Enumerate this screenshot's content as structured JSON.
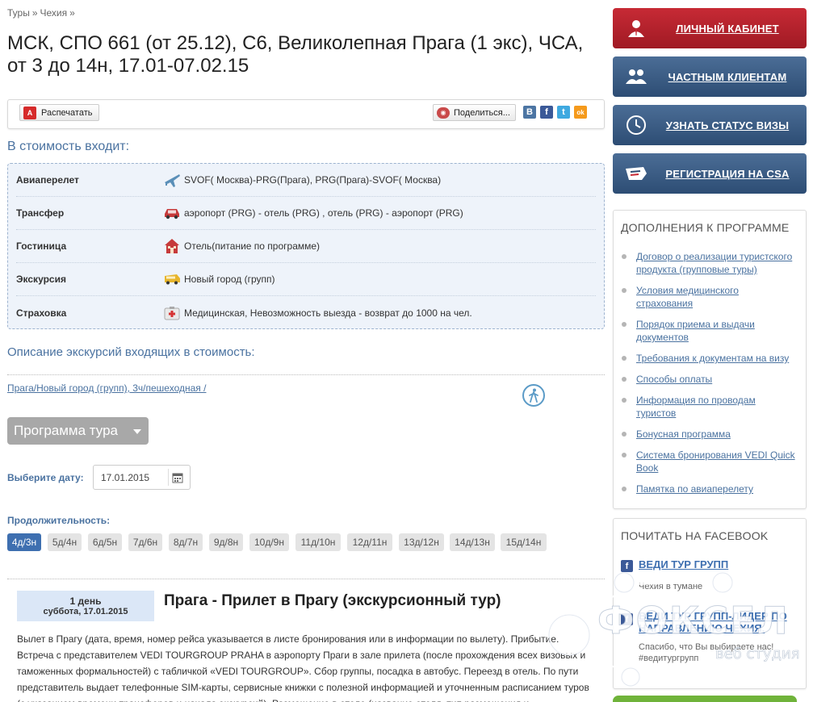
{
  "breadcrumb": {
    "items": [
      "Туры",
      "Чехия"
    ],
    "separator": "»"
  },
  "page": {
    "title": "МСК, СПО 661 (от 25.12), C6, Великолепная Прага (1 экс), ЧСА, от 3 до 14н, 17.01-07.02.15"
  },
  "toolbar": {
    "print_label": "Распечатать",
    "pdf_icon_text": "A",
    "share_label": "Поделиться...",
    "social": [
      {
        "letter": "В",
        "color": "#4c75a3"
      },
      {
        "letter": "f",
        "color": "#3b5998"
      },
      {
        "letter": "t",
        "color": "#3fa9e0"
      },
      {
        "letter": "ok",
        "color": "#f59a1c"
      }
    ]
  },
  "included": {
    "title": "В стоимость входит:",
    "rows": [
      {
        "label": "Авиаперелет",
        "icon": "plane-icon",
        "value": "SVOF( Москва)-PRG(Прага), PRG(Прага)-SVOF( Москва)"
      },
      {
        "label": "Трансфер",
        "icon": "car-icon",
        "value": "аэропорт (PRG) - отель (PRG) , отель (PRG) - аэропорт (PRG)"
      },
      {
        "label": "Гостиница",
        "icon": "hotel-icon",
        "value": "Отель(питание по программе)"
      },
      {
        "label": "Экскурсия",
        "icon": "bus-icon",
        "value": "Новый город (групп)"
      },
      {
        "label": "Страховка",
        "icon": "medkit-icon",
        "value": "Медицинская, Невозможность выезда - возврат до 1000 на чел."
      }
    ]
  },
  "excursions": {
    "title": "Описание экскурсий входящих в стоимость:",
    "link": "Прага/Новый город (групп), 3ч/пешеходная /"
  },
  "program": {
    "button_label": "Программа тура"
  },
  "date": {
    "label": "Выберите дату:",
    "value": "17.01.2015"
  },
  "duration": {
    "label": "Продолжительность:",
    "options": [
      "4д/3н",
      "5д/4н",
      "6д/5н",
      "7д/6н",
      "8д/7н",
      "9д/8н",
      "10д/9н",
      "11д/10н",
      "12д/11н",
      "13д/12н",
      "14д/13н",
      "15д/14н"
    ],
    "selected": "4д/3н"
  },
  "day": {
    "number": "1 день",
    "date": "суббота, 17.01.2015",
    "title": "Прага - Прилет в Прагу (экскурсионный тур)",
    "text": "Вылет в Прагу (дата, время, номер рейса указывается в листе бронирования или в информации по вылету). Прибытие. Встреча с представителем VEDI TOURGROUP PRAHA в аэропорту Праги в зале прилета (после прохождения всех визовых и таможенных формальностей) с табличкой «VEDI TOURGROUP». Сбор группы, посадка в автобус. Переезд в отель. По пути представитель выдает телефонные SIM-карты, сервисные книжки с полезной информацией и уточненным расписанием туров (с указанием времени трансферов и начала экскурсий). Размещение в отеле (название отеля, тип размещения и"
  },
  "sidebar": {
    "buttons": [
      {
        "label": "ЛИЧНЫЙ КАБИНЕТ",
        "icon": "user-icon"
      },
      {
        "label": "ЧАСТНЫМ КЛИЕНТАМ",
        "icon": "group-icon"
      },
      {
        "label": "УЗНАТЬ СТАТУС ВИЗЫ",
        "icon": "clock-icon"
      },
      {
        "label": "РЕГИСТРАЦИЯ НА CSA",
        "icon": "csa-logo-icon"
      }
    ],
    "addons": {
      "title": "ДОПОЛНЕНИЯ К ПРОГРАММЕ",
      "items": [
        "Договор о реализации туристского продукта (групповые туры)",
        "Условия медицинского страхования",
        "Порядок приема и выдачи документов",
        "Требования к документам на визу",
        "Способы оплаты",
        "Информация по проводам туристов",
        "Бонусная программа",
        "Система бронирования VEDI Quick Book",
        "Памятка по авиаперелету"
      ]
    },
    "facebook": {
      "title": "ПОЧИТАТЬ НА FACEBOOK",
      "posts": [
        {
          "name": "ВЕДИ ТУР ГРУПП",
          "sub": "Чехия в тумане"
        },
        {
          "name": "ВЕДИ ТУР ГРУПП-ЛИДЕР ПО НАПРАВЛЕНИЮ ЧЕХИЯ.",
          "sub": "Спасибо, что Вы выбираете нас! #ведитургрупп"
        }
      ]
    }
  },
  "watermark": {
    "brand": "ФОКСЕЛ",
    "tagline": "веб студия"
  },
  "colors": {
    "link": "#4a72a0",
    "accent_blue": "#3e6fb0",
    "side_red": "#b3222d",
    "side_blue": "#3c5c85"
  }
}
